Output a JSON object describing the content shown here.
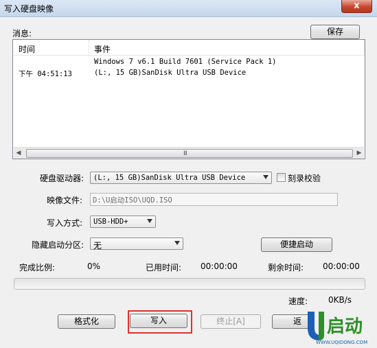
{
  "window": {
    "title": "写入硬盘映像",
    "close_label": "x"
  },
  "messages": {
    "label": "消息:",
    "save_label": "保存",
    "columns": {
      "time": "时间",
      "event": "事件"
    },
    "rows": [
      {
        "time": "",
        "event": "Windows 7 v6.1 Build 7601 (Service Pack 1)"
      },
      {
        "time": "下午 04:51:13",
        "event": "(L:, 15 GB)SanDisk Ultra USB Device"
      }
    ],
    "scroll_grip": "III"
  },
  "form": {
    "drive_label": "硬盘驱动器:",
    "drive_value": "(L:, 15 GB)SanDisk Ultra USB Device",
    "verify_label": "刻录校验",
    "verify_checked": false,
    "image_label": "映像文件:",
    "image_value": "D:\\U启动ISO\\UQD.ISO",
    "write_method_label": "写入方式:",
    "write_method_value": "USB-HDD+",
    "hidden_partition_label": "隐藏启动分区:",
    "hidden_partition_value": "无",
    "quick_boot_label": "便捷启动"
  },
  "status": {
    "completion_label": "完成比例:",
    "completion_value": "0%",
    "elapsed_label": "已用时间:",
    "elapsed_value": "00:00:00",
    "remaining_label": "剩余时间:",
    "remaining_value": "00:00:00",
    "speed_label": "速度:",
    "speed_value": "0KB/s",
    "progress_fraction": 0
  },
  "buttons": {
    "format": "格式化",
    "write": "写入",
    "stop": "终止[A]",
    "back_partial": "返"
  },
  "logo": {
    "brand": "U启动",
    "url": "WWW.UQIDONG.COM"
  },
  "colors": {
    "highlight": "#e0302c",
    "logo_blue": "#1d5fb8",
    "logo_green": "#2f8f2a"
  }
}
